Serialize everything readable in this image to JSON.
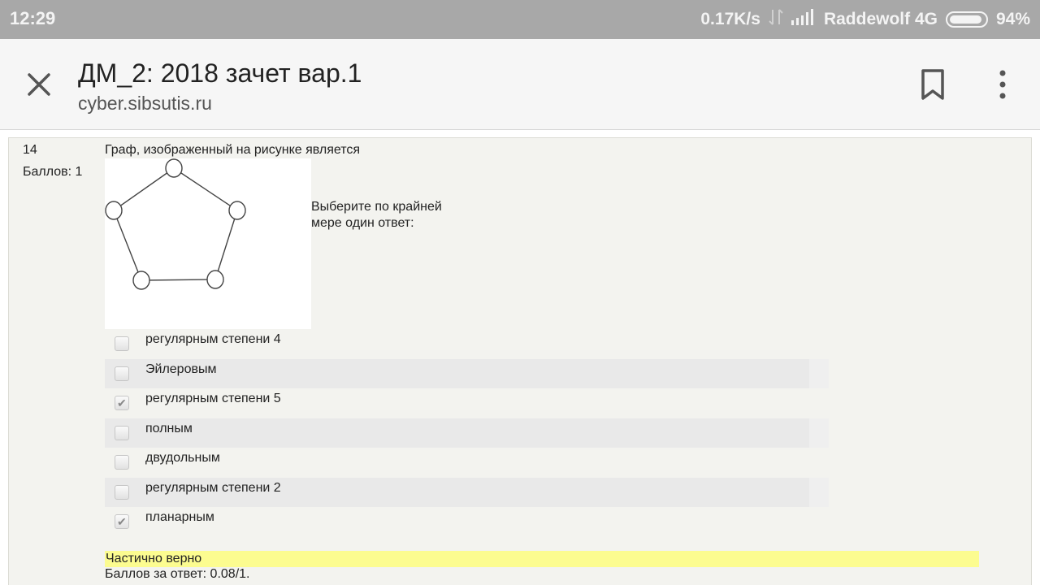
{
  "status_bar": {
    "time": "12:29",
    "speed": "0.17K/s",
    "carrier": "Raddewolf 4G",
    "battery": "94%",
    "battery_level": 0.94
  },
  "header": {
    "title": "ДМ_2: 2018 зачет вар.1",
    "url": "cyber.sibsutis.ru"
  },
  "question": {
    "number": "14",
    "grade": "Баллов: 1",
    "text": "Граф, изображенный на рисунке является",
    "prompt": "Выберите по крайней мере один ответ:",
    "answers": [
      {
        "label": "регулярным степени 4",
        "checked": false
      },
      {
        "label": "Эйлеровым",
        "checked": false
      },
      {
        "label": "регулярным степени 5",
        "checked": true
      },
      {
        "label": "полным",
        "checked": false
      },
      {
        "label": "двудольным",
        "checked": false
      },
      {
        "label": "регулярным степени 2",
        "checked": false
      },
      {
        "label": "планарным",
        "checked": true
      }
    ],
    "feedback": "Частично верно",
    "score": "Баллов за ответ: 0.08/1."
  },
  "colors": {
    "status_bar_bg": "#a8a8a8",
    "feedback_highlight": "#fcfc90"
  },
  "icons": {
    "close": "close-icon",
    "bookmark": "bookmark-icon",
    "menu": "more-vert-icon"
  }
}
